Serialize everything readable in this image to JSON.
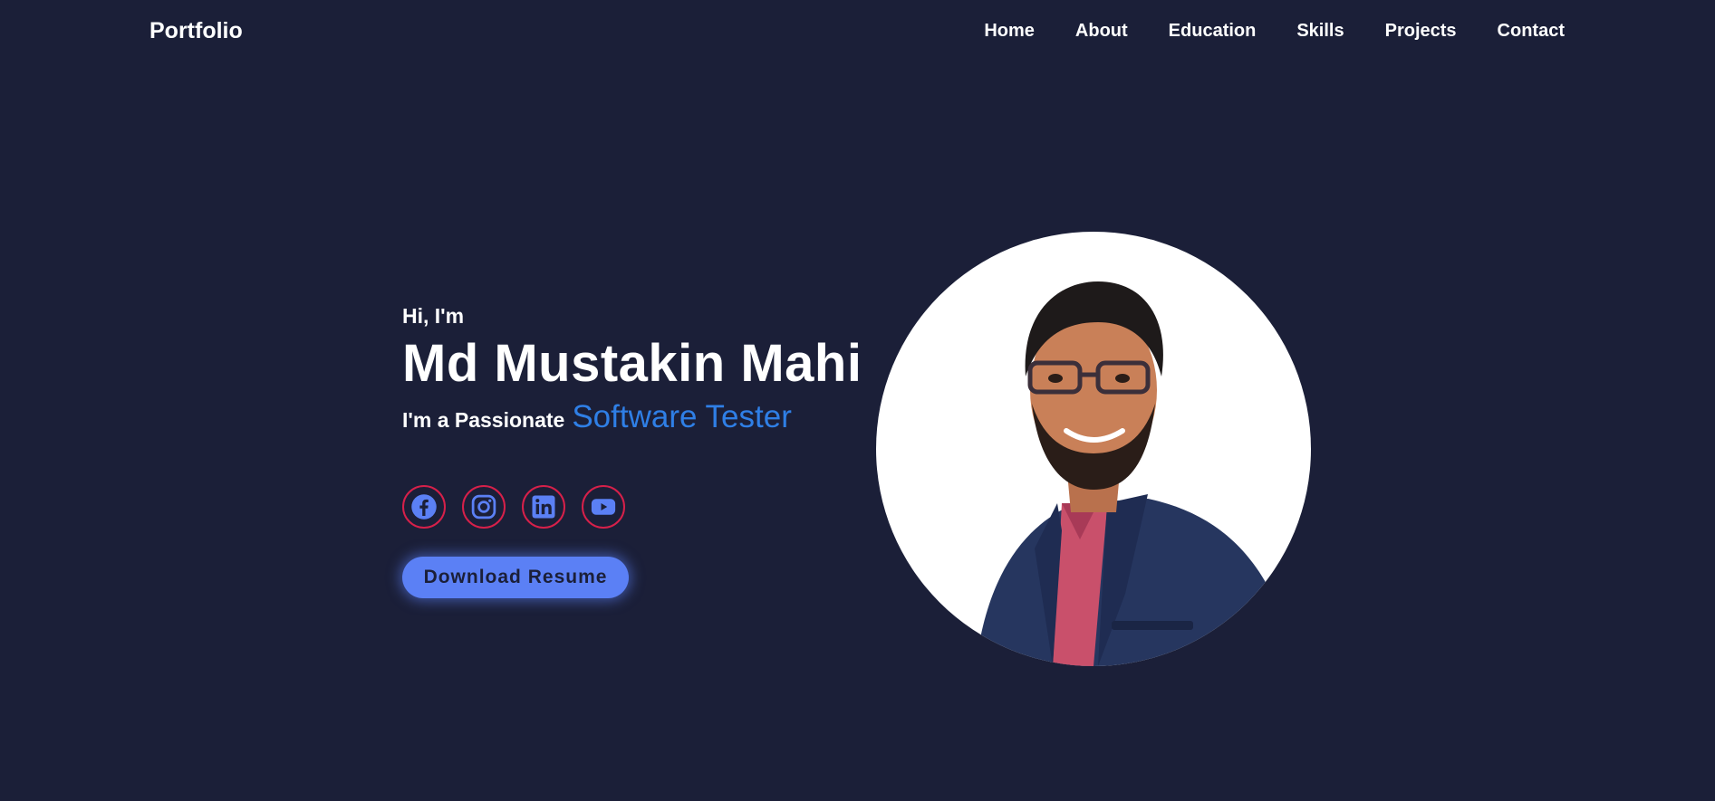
{
  "nav": {
    "brand": "Portfolio",
    "links": [
      "Home",
      "About",
      "Education",
      "Skills",
      "Projects",
      "Contact"
    ]
  },
  "hero": {
    "greeting": "Hi, I'm",
    "name": "Md Mustakin Mahi",
    "tagline_prefix": "I'm a Passionate",
    "tagline_role": "Software Tester",
    "resume_label": "Download Resume"
  },
  "socials": [
    {
      "icon": "facebook-icon"
    },
    {
      "icon": "instagram-icon"
    },
    {
      "icon": "linkedin-icon"
    },
    {
      "icon": "youtube-icon"
    }
  ],
  "colors": {
    "background": "#1b1f38",
    "accent_blue": "#2f7fe6",
    "button": "#5b80f5",
    "social_border": "#d6204a",
    "icon_fill": "#5b80f5"
  }
}
